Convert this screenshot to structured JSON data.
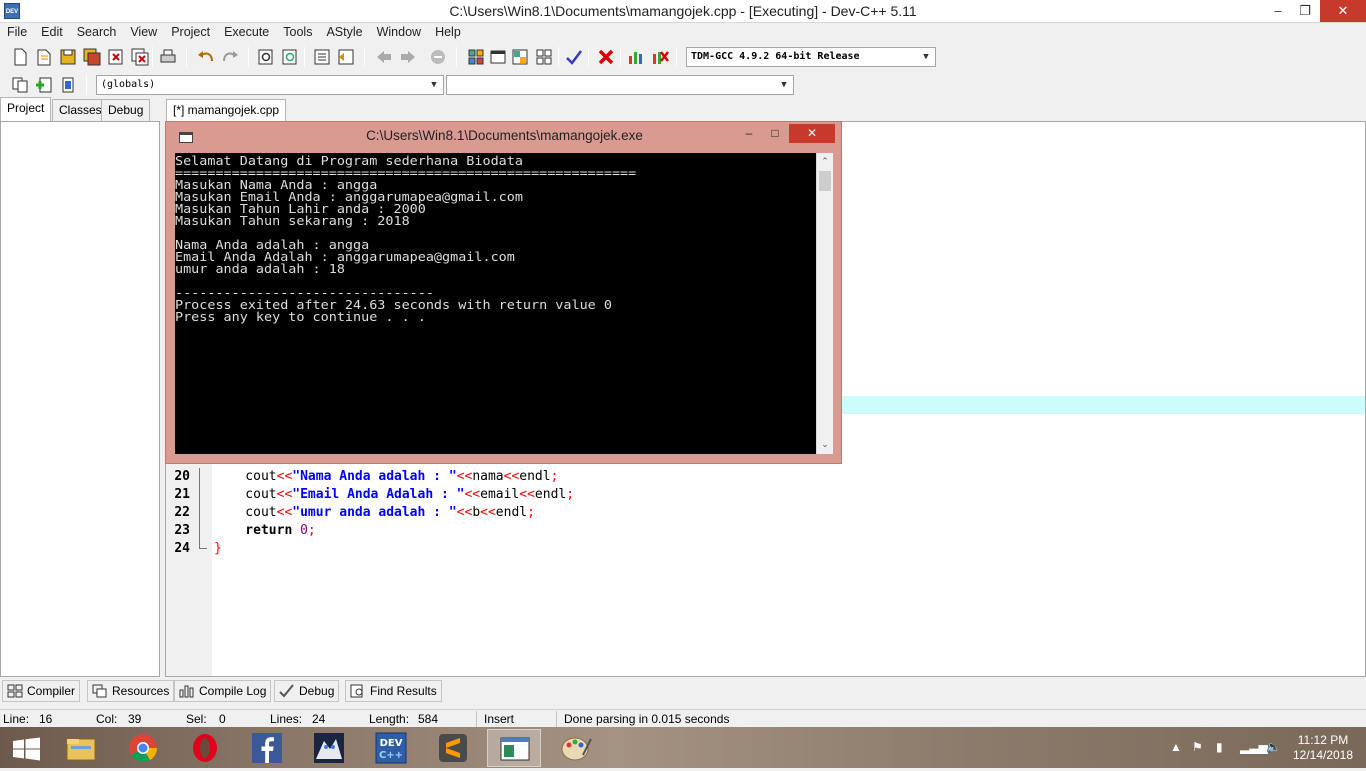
{
  "window": {
    "title": "C:\\Users\\Win8.1\\Documents\\mamangojek.cpp - [Executing] - Dev-C++ 5.11",
    "app_icon_text": "DEV"
  },
  "menu": [
    "File",
    "Edit",
    "Search",
    "View",
    "Project",
    "Execute",
    "Tools",
    "AStyle",
    "Window",
    "Help"
  ],
  "toolbar": {
    "compiler_select": "TDM-GCC 4.9.2 64-bit Release",
    "scope_select": "(globals)",
    "member_select": ""
  },
  "left_tabs": [
    "Project",
    "Classes",
    "Debug"
  ],
  "editor": {
    "tab_label": "[*] mamangojek.cpp",
    "lines": [
      {
        "n": "20",
        "parts": [
          [
            "id",
            "    cout"
          ],
          [
            "op",
            "<<"
          ],
          [
            "str",
            "\"Nama Anda adalah : \""
          ],
          [
            "op",
            "<<"
          ],
          [
            "id",
            "nama"
          ],
          [
            "op",
            "<<"
          ],
          [
            "id",
            "endl"
          ],
          [
            "op",
            ";"
          ]
        ]
      },
      {
        "n": "21",
        "parts": [
          [
            "id",
            "    cout"
          ],
          [
            "op",
            "<<"
          ],
          [
            "str",
            "\"Email Anda Adalah : \""
          ],
          [
            "op",
            "<<"
          ],
          [
            "id",
            "email"
          ],
          [
            "op",
            "<<"
          ],
          [
            "id",
            "endl"
          ],
          [
            "op",
            ";"
          ]
        ]
      },
      {
        "n": "22",
        "parts": [
          [
            "id",
            "    cout"
          ],
          [
            "op",
            "<<"
          ],
          [
            "str",
            "\"umur anda adalah : \""
          ],
          [
            "op",
            "<<"
          ],
          [
            "id",
            "b"
          ],
          [
            "op",
            "<<"
          ],
          [
            "id",
            "endl"
          ],
          [
            "op",
            ";"
          ]
        ]
      },
      {
        "n": "23",
        "parts": [
          [
            "kw",
            "    return "
          ],
          [
            "num",
            "0"
          ],
          [
            "op",
            ";"
          ]
        ]
      },
      {
        "n": "24",
        "parts": [
          [
            "op",
            "}"
          ]
        ]
      }
    ]
  },
  "console": {
    "title": "C:\\Users\\Win8.1\\Documents\\mamangojek.exe",
    "lines": [
      "Selamat Datang di Program sederhana Biodata",
      "=========================================================",
      "Masukan Nama Anda : angga",
      "Masukan Email Anda : anggarumapea@gmail.com",
      "Masukan Tahun Lahir anda : 2000",
      "Masukan Tahun sekarang : 2018",
      "",
      "Nama Anda adalah : angga",
      "Email Anda Adalah : anggarumapea@gmail.com",
      "umur anda adalah : 18",
      "",
      "--------------------------------",
      "Process exited after 24.63 seconds with return value 0",
      "Press any key to continue . . ."
    ]
  },
  "bottom_tabs": [
    "Compiler",
    "Resources",
    "Compile Log",
    "Debug",
    "Find Results"
  ],
  "status": {
    "line_label": "Line:",
    "line_value": "16",
    "col_label": "Col:",
    "col_value": "39",
    "sel_label": "Sel:",
    "sel_value": "0",
    "lines_label": "Lines:",
    "lines_value": "24",
    "length_label": "Length:",
    "length_value": "584",
    "mode": "Insert",
    "message": "Done parsing in 0.015 seconds"
  },
  "taskbar": {
    "time": "11:12 PM",
    "date": "12/14/2018",
    "apps": [
      "start",
      "file-explorer",
      "chrome",
      "opera",
      "facebook",
      "anime-app",
      "dev-cpp",
      "sublime",
      "active-window",
      "paint"
    ]
  }
}
